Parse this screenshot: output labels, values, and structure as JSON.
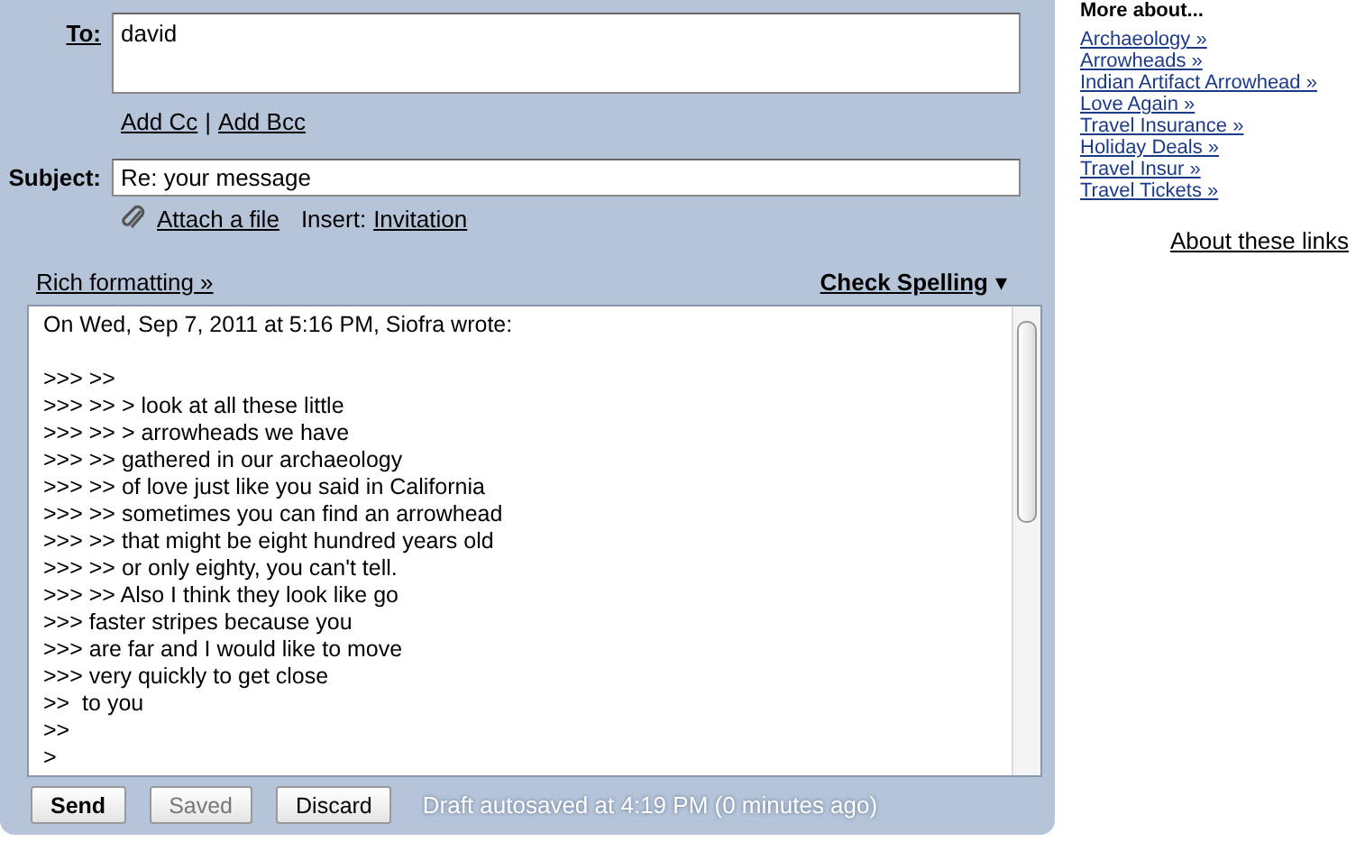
{
  "compose": {
    "to": {
      "label": "To:",
      "value": "david"
    },
    "cc_links": [
      {
        "label": "Add Cc"
      },
      {
        "label": "Add Bcc"
      }
    ],
    "cc_separator": "|",
    "subject": {
      "label": "Subject:",
      "value": "Re: your message"
    },
    "attach": {
      "label": "Attach a file"
    },
    "insert": {
      "label": "Insert:",
      "link": "Invitation"
    },
    "rich_formatting": "Rich formatting »",
    "check_spelling": "Check Spelling",
    "check_spelling_caret": "▾",
    "body": "On Wed, Sep 7, 2011 at 5:16 PM, Siofra wrote:\n\n>>> >>\n>>> >> > look at all these little\n>>> >> > arrowheads we have\n>>> >> gathered in our archaeology\n>>> >> of love just like you said in California\n>>> >> sometimes you can find an arrowhead\n>>> >> that might be eight hundred years old\n>>> >> or only eighty, you can't tell.\n>>> >> Also I think they look like go\n>>> faster stripes because you\n>>> are far and I would like to move\n>>> very quickly to get close\n>>  to you\n>>\n>",
    "buttons": [
      {
        "label": "Send",
        "kind": "primary",
        "disabled": false
      },
      {
        "label": "Saved",
        "kind": "normal",
        "disabled": true
      },
      {
        "label": "Discard",
        "kind": "normal",
        "disabled": false
      }
    ],
    "status": "Draft autosaved at 4:19 PM (0 minutes ago)"
  },
  "sidebar": {
    "title": "More about...",
    "links": [
      "Archaeology »",
      "Arrowheads »",
      "Indian Artifact Arrowhead »",
      "Love Again »",
      "Travel Insurance »",
      "Holiday Deals »",
      "Travel Insur »",
      "Travel Tickets »"
    ],
    "about": "About these links"
  }
}
